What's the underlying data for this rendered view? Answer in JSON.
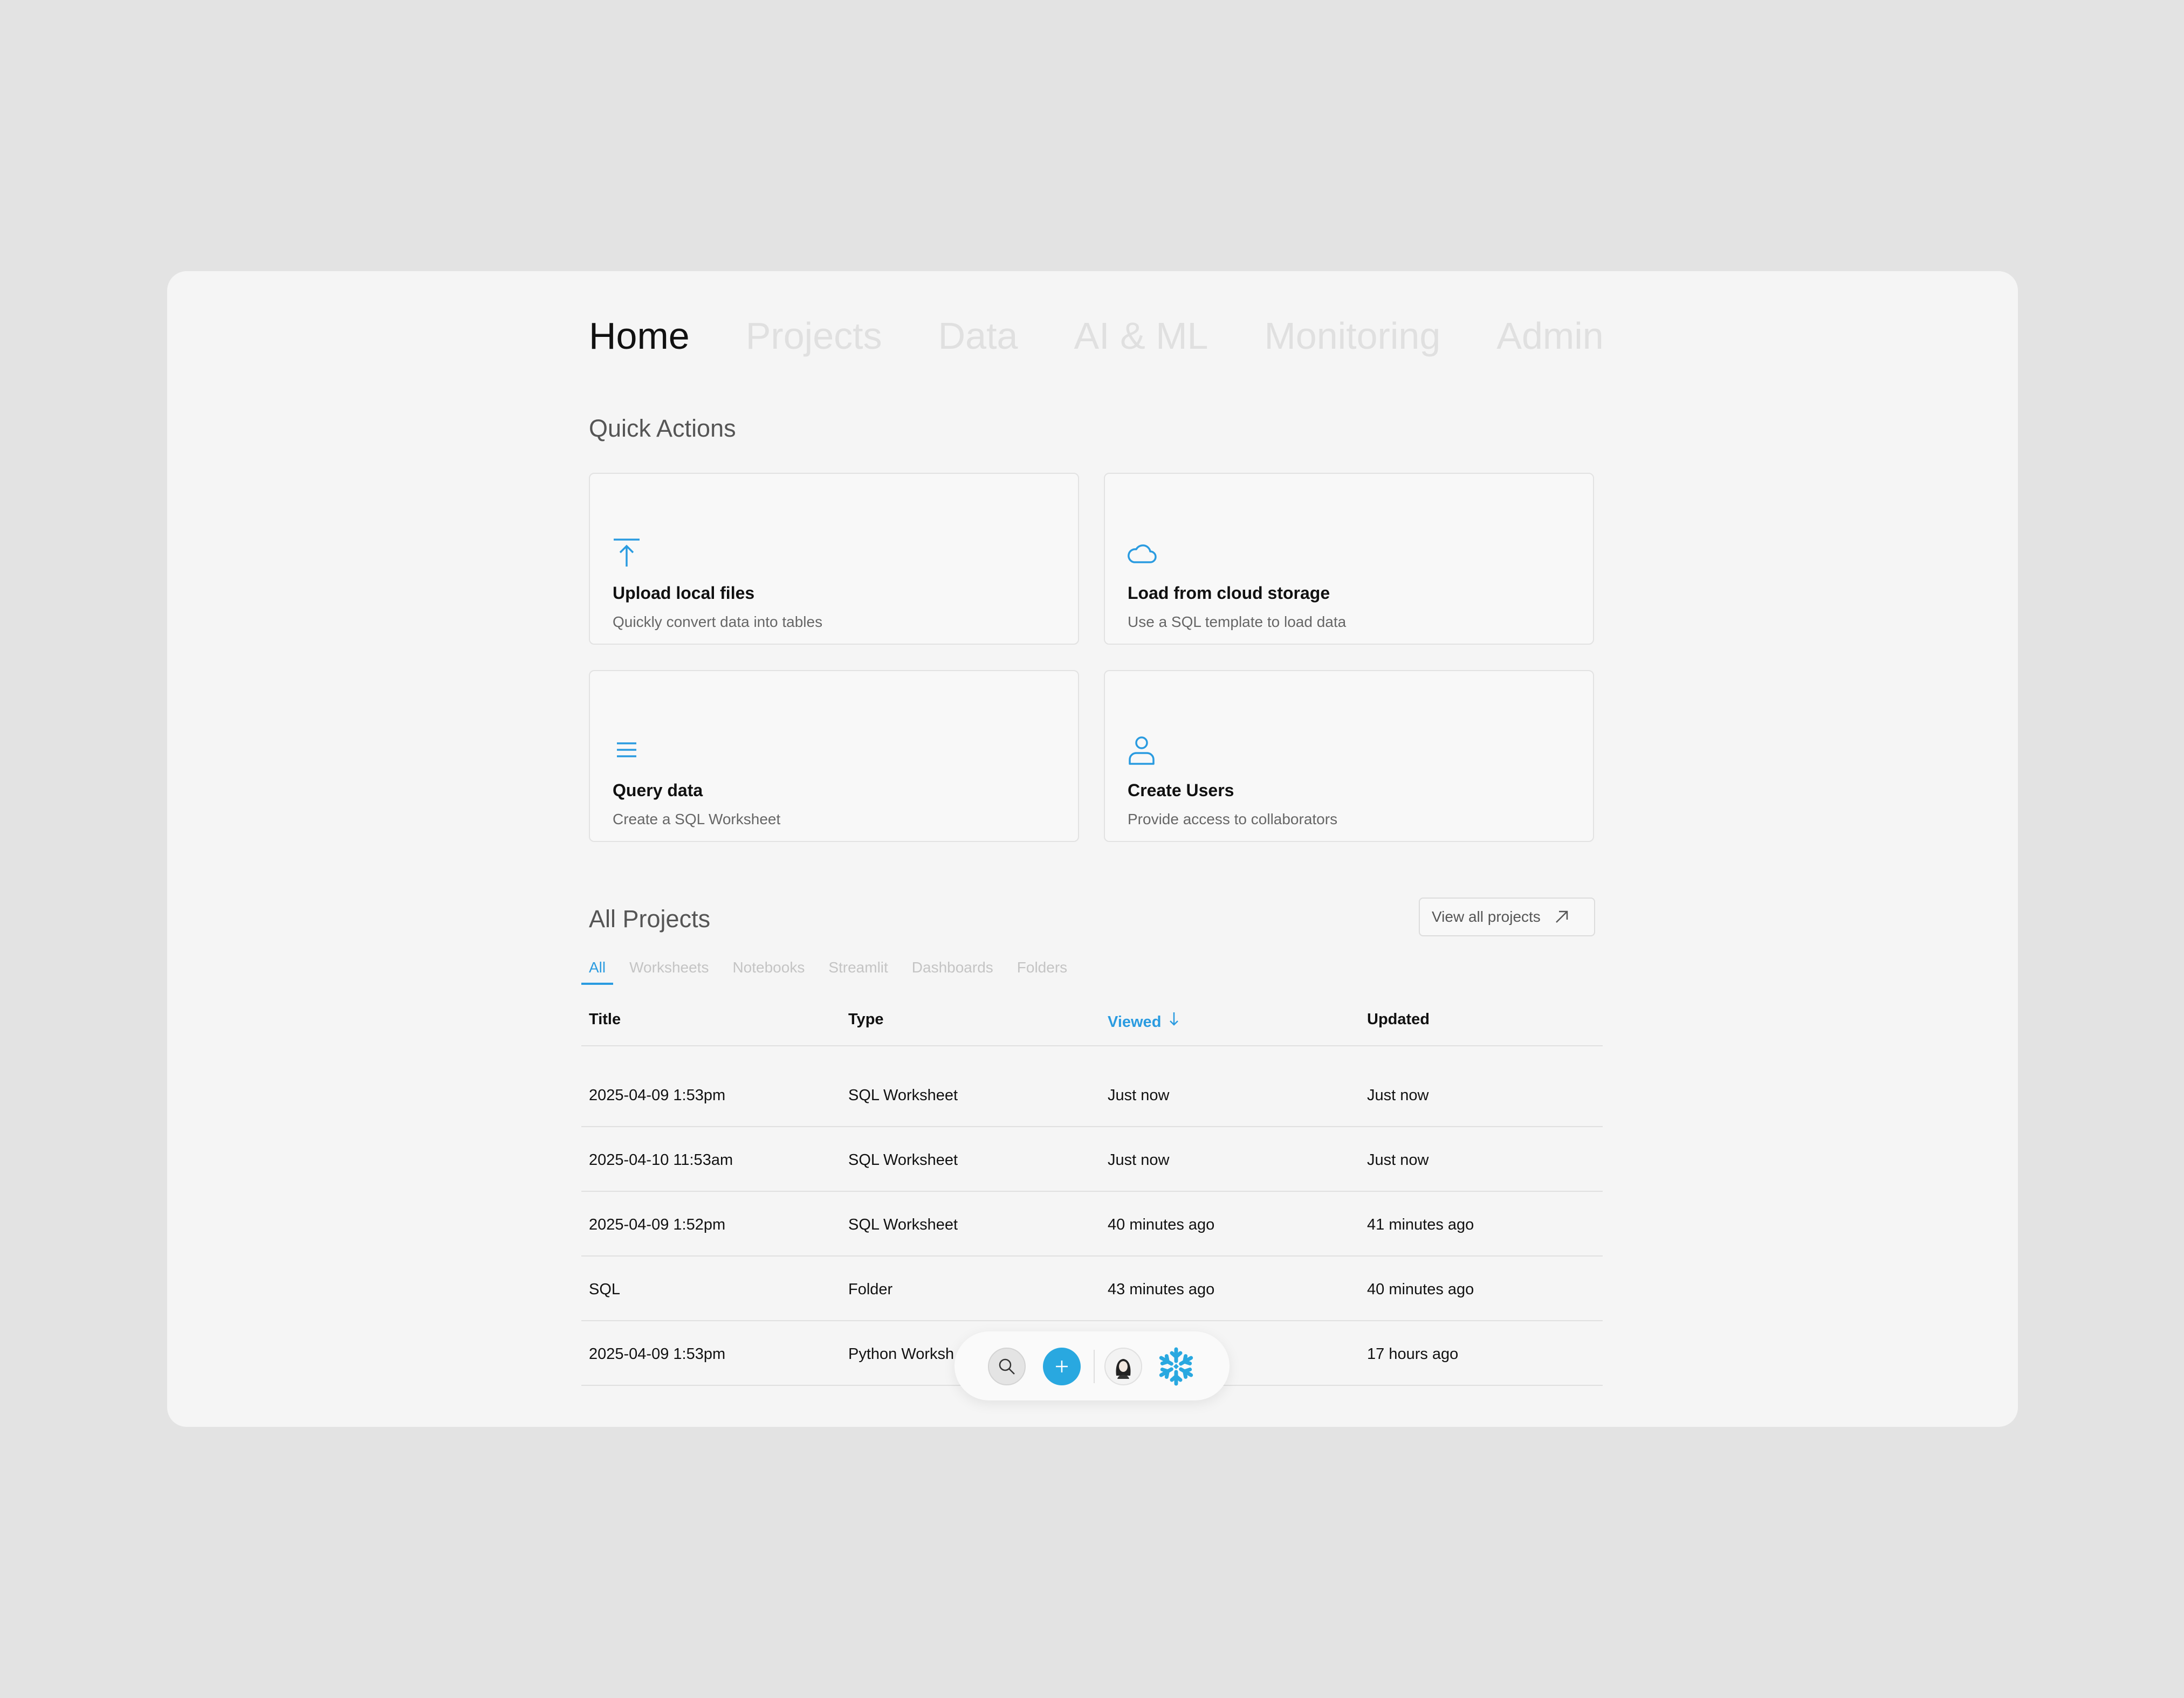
{
  "nav": {
    "items": [
      "Home",
      "Projects",
      "Data",
      "AI & ML",
      "Monitoring",
      "Admin"
    ],
    "active": "Home"
  },
  "quick_actions": {
    "title": "Quick Actions",
    "cards": [
      {
        "icon": "upload-icon",
        "title": "Upload local files",
        "desc": "Quickly convert data into tables"
      },
      {
        "icon": "cloud-icon",
        "title": "Load from cloud storage",
        "desc": "Use a SQL template to load data"
      },
      {
        "icon": "list-icon",
        "title": "Query data",
        "desc": "Create a SQL Worksheet"
      },
      {
        "icon": "user-icon",
        "title": "Create Users",
        "desc": "Provide access to collaborators"
      }
    ]
  },
  "projects": {
    "title": "All Projects",
    "view_all_label": "View all projects",
    "tabs": [
      "All",
      "Worksheets",
      "Notebooks",
      "Streamlit",
      "Dashboards",
      "Folders"
    ],
    "active_tab": "All",
    "columns": [
      "Title",
      "Type",
      "Viewed",
      "Updated"
    ],
    "sorted_column": "Viewed",
    "rows": [
      [
        "2025-04-09 1:53pm",
        "SQL Worksheet",
        "Just now",
        "Just now"
      ],
      [
        "2025-04-10 11:53am",
        "SQL Worksheet",
        "Just now",
        "Just now"
      ],
      [
        "2025-04-09 1:52pm",
        "SQL Worksheet",
        "40 minutes ago",
        "41 minutes ago"
      ],
      [
        "SQL",
        "Folder",
        "43 minutes ago",
        "40 minutes ago"
      ],
      [
        "2025-04-09 1:53pm",
        "Python Worksh",
        "",
        "17 hours ago"
      ]
    ]
  },
  "toolbar": {
    "icons": [
      "search-icon",
      "plus-icon",
      "avatar",
      "snowflake-logo-icon"
    ]
  },
  "colors": {
    "accent": "#2a9be0",
    "background": "#e3e3e3",
    "panel": "#f5f5f5"
  }
}
